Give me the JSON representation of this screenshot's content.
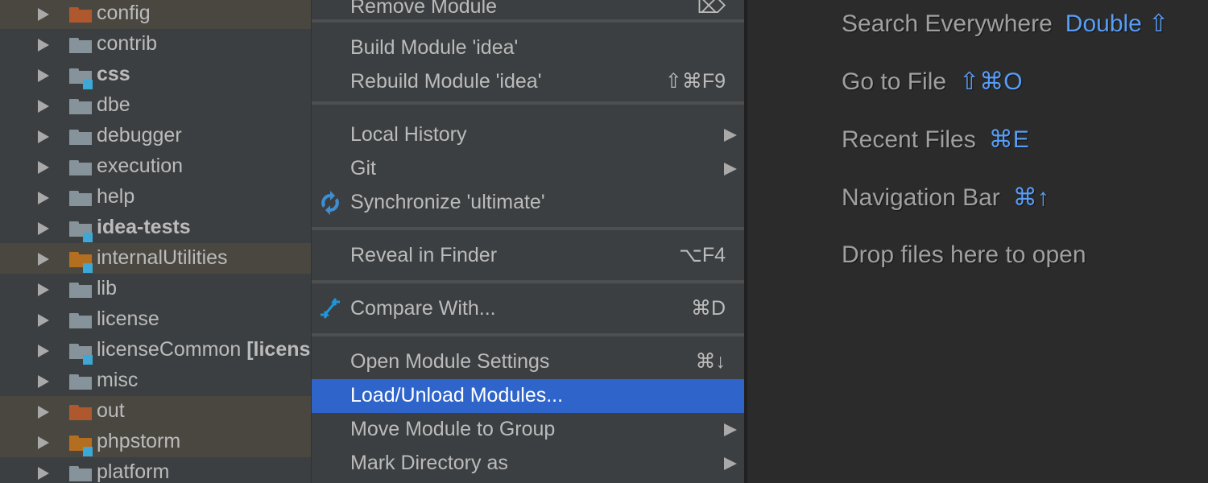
{
  "project_tree": {
    "items": [
      {
        "name": "config",
        "folder_color": "#b0582d",
        "module": false,
        "bold": false,
        "excluded": true
      },
      {
        "name": "contrib",
        "folder_color": "#87939a",
        "module": false,
        "bold": false,
        "excluded": false
      },
      {
        "name": "css",
        "folder_color": "#87939a",
        "module": true,
        "bold": true,
        "excluded": false
      },
      {
        "name": "dbe",
        "folder_color": "#87939a",
        "module": false,
        "bold": false,
        "excluded": false
      },
      {
        "name": "debugger",
        "folder_color": "#87939a",
        "module": false,
        "bold": false,
        "excluded": false
      },
      {
        "name": "execution",
        "folder_color": "#87939a",
        "module": false,
        "bold": false,
        "excluded": false
      },
      {
        "name": "help",
        "folder_color": "#87939a",
        "module": false,
        "bold": false,
        "excluded": false
      },
      {
        "name": "idea-tests",
        "folder_color": "#87939a",
        "module": true,
        "bold": true,
        "excluded": false
      },
      {
        "name": "internalUtilities",
        "folder_color": "#b46e1f",
        "module": true,
        "bold": false,
        "excluded": true
      },
      {
        "name": "lib",
        "folder_color": "#87939a",
        "module": false,
        "bold": false,
        "excluded": false
      },
      {
        "name": "license",
        "folder_color": "#87939a",
        "module": false,
        "bold": false,
        "excluded": false
      },
      {
        "name": "licenseCommon",
        "extra": "[license_common]",
        "folder_color": "#87939a",
        "module": true,
        "bold": false,
        "excluded": false
      },
      {
        "name": "misc",
        "folder_color": "#87939a",
        "module": false,
        "bold": false,
        "excluded": false
      },
      {
        "name": "out",
        "folder_color": "#b0582d",
        "module": false,
        "bold": false,
        "excluded": true
      },
      {
        "name": "phpstorm",
        "folder_color": "#b46e1f",
        "module": true,
        "bold": false,
        "excluded": true
      },
      {
        "name": "platform",
        "folder_color": "#87939a",
        "module": false,
        "bold": false,
        "excluded": false
      }
    ]
  },
  "context_menu": {
    "items": [
      {
        "label": "Remove Module",
        "shortcut": "⌦",
        "type": "item"
      },
      {
        "type": "separator"
      },
      {
        "label": "Build Module 'idea'",
        "shortcut": "",
        "type": "item"
      },
      {
        "label": "Rebuild Module 'idea'",
        "shortcut": "⇧⌘F9",
        "type": "item"
      },
      {
        "type": "separator"
      },
      {
        "label": "Local History",
        "submenu": true,
        "type": "item"
      },
      {
        "label": "Git",
        "submenu": true,
        "type": "item"
      },
      {
        "label": "Synchronize 'ultimate'",
        "icon": "sync-icon",
        "type": "item"
      },
      {
        "type": "separator"
      },
      {
        "label": "Reveal in Finder",
        "shortcut": "⌥F4",
        "type": "item"
      },
      {
        "type": "separator"
      },
      {
        "label": "Compare With...",
        "shortcut": "⌘D",
        "icon": "compare-icon",
        "type": "item"
      },
      {
        "type": "separator"
      },
      {
        "label": "Open Module Settings",
        "shortcut": "⌘↓",
        "type": "item"
      },
      {
        "label": "Load/Unload Modules...",
        "selected": true,
        "type": "item"
      },
      {
        "label": "Move Module to Group",
        "submenu": true,
        "type": "item"
      },
      {
        "label": "Mark Directory as",
        "submenu": true,
        "type": "item"
      }
    ],
    "selected_color": "#2f65ca"
  },
  "editor_hints": [
    {
      "label": "Search Everywhere",
      "key": "Double ⇧"
    },
    {
      "label": "Go to File",
      "key": "⇧⌘O"
    },
    {
      "label": "Recent Files",
      "key": "⌘E"
    },
    {
      "label": "Navigation Bar",
      "key": "⌘↑"
    },
    {
      "label": "Drop files here to open",
      "key": ""
    }
  ],
  "colors": {
    "accent_key": "#589df6",
    "module_marker": "#3da7d5"
  }
}
